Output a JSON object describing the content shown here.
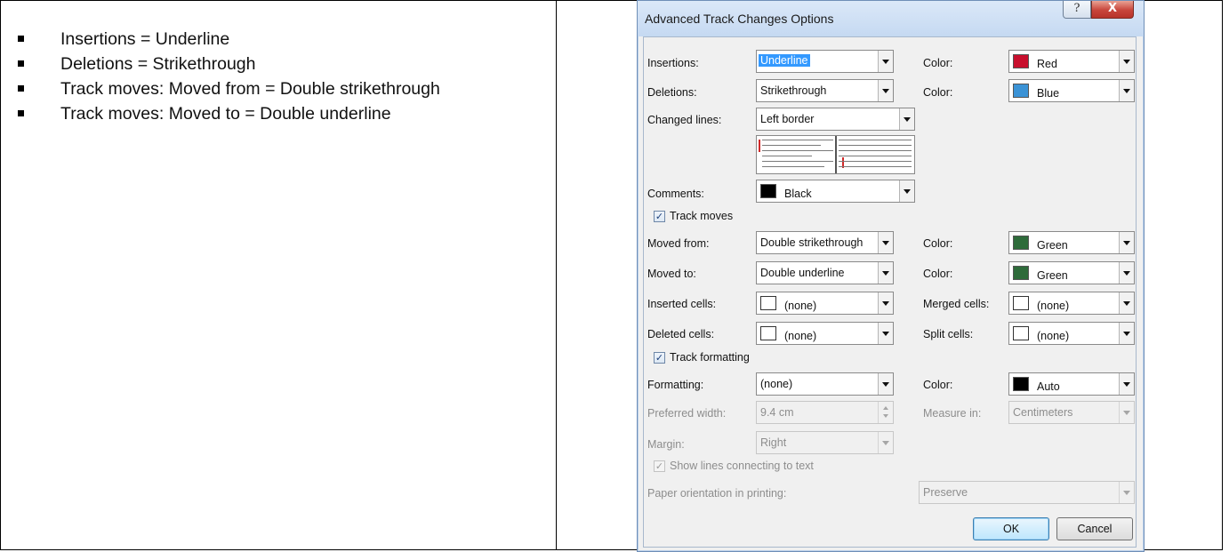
{
  "document": {
    "bullets": [
      "Insertions = Underline",
      "Deletions = Strikethrough",
      "Track moves: Moved from = Double strikethrough",
      "Track moves: Moved to = Double underline"
    ]
  },
  "dialog": {
    "title": "Advanced Track Changes Options",
    "help_glyph": "?",
    "close_glyph": "X",
    "insertions": {
      "label": "Insertions:",
      "value": "Underline",
      "color_label": "Color:",
      "color_value": "Red",
      "swatch": "#c8102e"
    },
    "deletions": {
      "label": "Deletions:",
      "value": "Strikethrough",
      "color_label": "Color:",
      "color_value": "Blue",
      "swatch": "#3b93d6"
    },
    "changed_lines": {
      "label": "Changed lines:",
      "value": "Left border"
    },
    "comments": {
      "label": "Comments:",
      "color_value": "Black",
      "swatch": "#000000"
    },
    "track_moves": {
      "label": "Track moves",
      "checked": true
    },
    "moved_from": {
      "label": "Moved from:",
      "value": "Double strikethrough",
      "color_label": "Color:",
      "color_value": "Green",
      "swatch": "#2e6b3a"
    },
    "moved_to": {
      "label": "Moved to:",
      "value": "Double underline",
      "color_label": "Color:",
      "color_value": "Green",
      "swatch": "#2e6b3a"
    },
    "inserted_cells": {
      "label": "Inserted cells:",
      "value": "(none)"
    },
    "merged_cells": {
      "label": "Merged cells:",
      "value": "(none)"
    },
    "deleted_cells": {
      "label": "Deleted cells:",
      "value": "(none)"
    },
    "split_cells": {
      "label": "Split cells:",
      "value": "(none)"
    },
    "track_formatting": {
      "label": "Track formatting",
      "checked": true
    },
    "formatting": {
      "label": "Formatting:",
      "value": "(none)",
      "color_label": "Color:",
      "color_value": "Auto",
      "swatch": "#000000"
    },
    "preferred_width": {
      "label": "Preferred width:",
      "value": "9.4 cm",
      "measure_label": "Measure in:",
      "measure_value": "Centimeters"
    },
    "margin": {
      "label": "Margin:",
      "value": "Right"
    },
    "show_lines": {
      "label": "Show lines connecting to text",
      "checked": true
    },
    "paper_orientation": {
      "label": "Paper orientation in printing:",
      "value": "Preserve"
    },
    "ok_label": "OK",
    "cancel_label": "Cancel"
  }
}
